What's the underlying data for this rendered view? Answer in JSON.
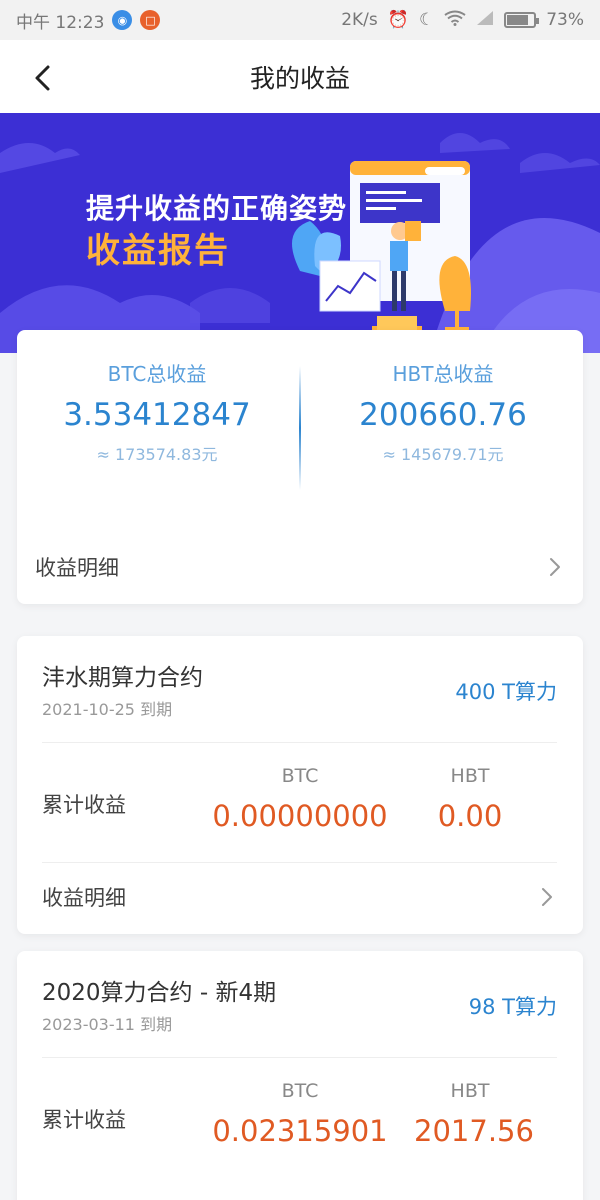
{
  "status_bar": {
    "time": "中午 12:23",
    "speed": "2K/s",
    "battery": "73%",
    "battery_level": 0.73
  },
  "nav": {
    "title": "我的收益"
  },
  "banner": {
    "line1": "提升收益的正确姿势",
    "line2": "收益报告"
  },
  "summary": {
    "btc_label": "BTC总收益",
    "btc_value": "3.53412847",
    "btc_approx": "≈ 173574.83元",
    "hbt_label": "HBT总收益",
    "hbt_value": "200660.76",
    "hbt_approx": "≈ 145679.71元",
    "detail_label": "收益明细"
  },
  "contracts": [
    {
      "title": "沣水期算力合约",
      "date": "2021-10-25 到期",
      "power": "400 T算力",
      "cum_label": "累计收益",
      "btc_head": "BTC",
      "hbt_head": "HBT",
      "btc_value": "0.00000000",
      "hbt_value": "0.00",
      "detail_label": "收益明细"
    },
    {
      "title": "2020算力合约 - 新4期",
      "date": "2023-03-11 到期",
      "power": "98 T算力",
      "cum_label": "累计收益",
      "btc_head": "BTC",
      "hbt_head": "HBT",
      "btc_value": "0.02315901",
      "hbt_value": "2017.56"
    }
  ],
  "colors": {
    "banner_bg": "#3c2fd4",
    "accent_blue": "#2b84cf",
    "accent_orange": "#e05a23",
    "banner_highlight": "#ffb23a"
  },
  "icons": {
    "back": "chevron-left-icon",
    "detail": "chevron-right-icon",
    "banner_illustration": "report-illustration"
  }
}
